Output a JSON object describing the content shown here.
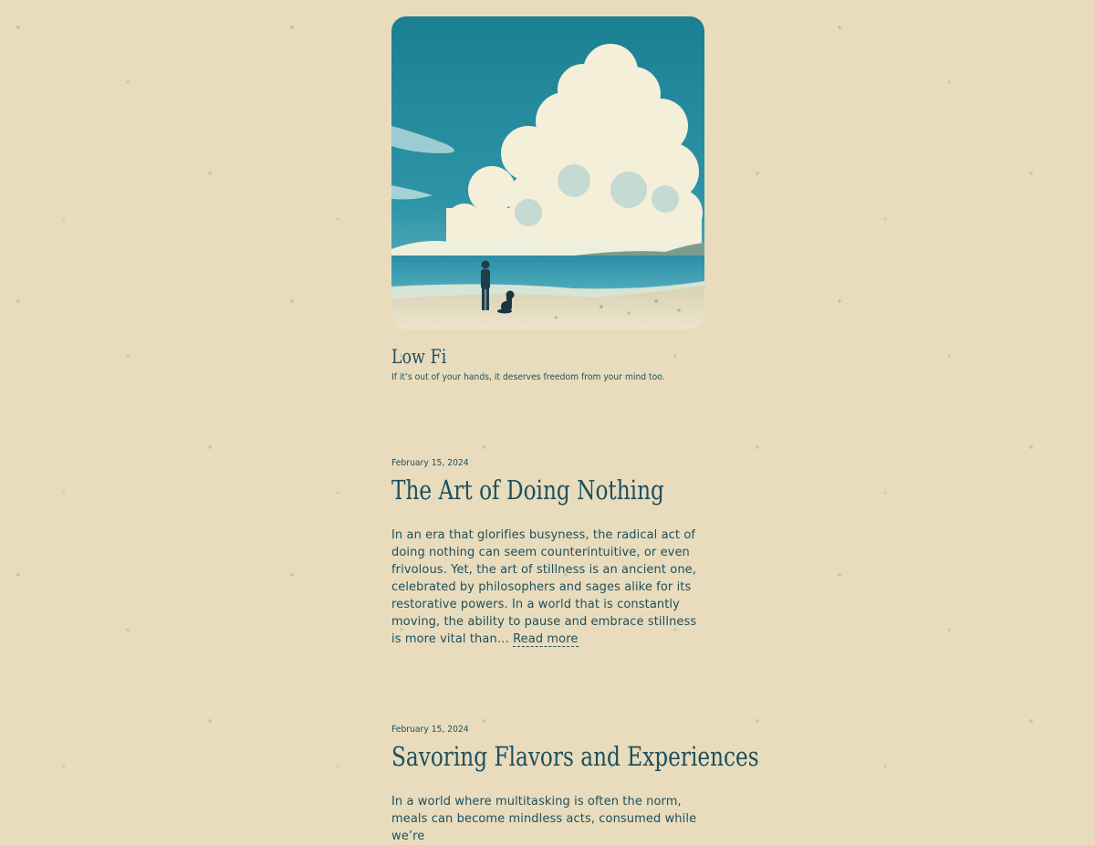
{
  "site": {
    "title": "Low Fi",
    "tagline": "If it’s out of your hands, it deserves freedom from your mind too."
  },
  "hero_image": {
    "description_icon": "beach-cloud-illustration-icon"
  },
  "posts": [
    {
      "date": "February 15, 2024",
      "title": "The Art of Doing Nothing",
      "excerpt": "In an era that glorifies busyness, the radical act of doing nothing can seem counterintuitive, or even frivolous. Yet, the art of stillness is an ancient one, celebrated by philosophers and sages alike for its restorative powers. In a world that is constantly moving, the ability to pause and embrace stillness is more vital than…",
      "read_more": "Read more"
    },
    {
      "date": "February 15, 2024",
      "title": "Savoring Flavors and Experiences",
      "excerpt": "In a world where multitasking is often the norm, meals can become mindless acts, consumed while we’re"
    }
  ],
  "colors": {
    "background": "#e8dcbd",
    "text": "#1e4f5c"
  }
}
